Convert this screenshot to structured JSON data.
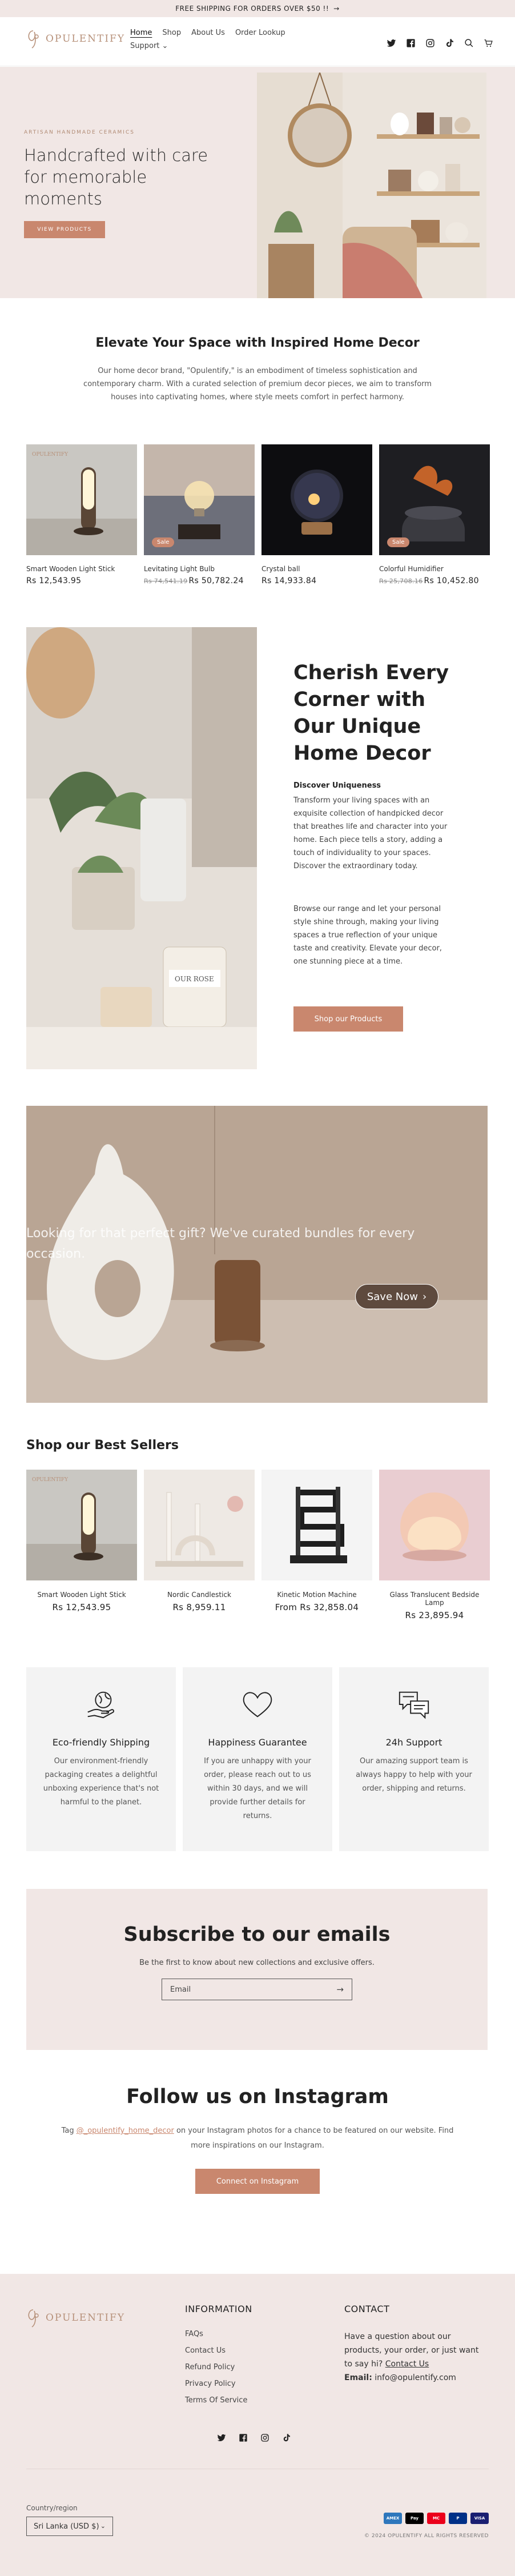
{
  "announcement": {
    "text": "FREE SHIPPING FOR ORDERS OVER $50 !!",
    "arrow": "→"
  },
  "header": {
    "logo_text": "OPULENTIFY",
    "nav": [
      {
        "label": "Home",
        "active": true
      },
      {
        "label": "Shop"
      },
      {
        "label": "About Us"
      },
      {
        "label": "Order Lookup"
      },
      {
        "label": "Support ⌄"
      }
    ],
    "icons": [
      "twitter-icon",
      "facebook-icon",
      "instagram-icon",
      "tiktok-icon",
      "search-icon",
      "cart-icon"
    ]
  },
  "hero": {
    "eyebrow": "ARTISAN HANDMADE CERAMICS",
    "title": "Handcrafted with care for memorable moments",
    "button": "VIEW PRODUCTS"
  },
  "elevate": {
    "title": "Elevate Your Space with Inspired Home Decor",
    "text": "Our home decor brand, \"Opulentify,\" is an embodiment of timeless sophistication and contemporary charm. With a curated selection of premium decor pieces, we aim to transform houses into captivating homes, where style meets comfort in perfect harmony."
  },
  "products": [
    {
      "name": "Smart Wooden Light Stick",
      "price": "Rs 12,543.95",
      "old_price": "",
      "sale": ""
    },
    {
      "name": "Levitating Light Bulb",
      "price": "Rs 50,782.24",
      "old_price": "Rs 74,541.19",
      "sale": "Sale"
    },
    {
      "name": "Crystal ball",
      "price": "Rs 14,933.84",
      "old_price": "",
      "sale": ""
    },
    {
      "name": "Colorful Humidifier",
      "price": "Rs 10,452.80",
      "old_price": "Rs 25,708.16",
      "sale": "Sale"
    }
  ],
  "cherish": {
    "title": "Cherish Every Corner with Our Unique Home Decor",
    "subtitle": "Discover Uniqueness",
    "p1": "Transform your living spaces with an exquisite collection of handpicked decor that breathes life and character into your home. Each piece tells a story, adding a touch of individuality to your spaces. Discover the extraordinary today.",
    "p2": "Browse our range and let your personal style shine through, making your living spaces a true reflection of your unique taste and creativity. Elevate your decor, one stunning piece at a time.",
    "button": "Shop our Products"
  },
  "banner": {
    "text": "Looking for that perfect gift? We've curated bundles for every occasion.",
    "button": "Save Now",
    "arrow": "›"
  },
  "best_sellers": {
    "title": "Shop our Best Sellers",
    "items": [
      {
        "name": "Smart Wooden Light Stick",
        "price": "Rs 12,543.95"
      },
      {
        "name": "Nordic Candlestick",
        "price": "Rs 8,959.11"
      },
      {
        "name": "Kinetic Motion Machine",
        "price": "From Rs 32,858.04"
      },
      {
        "name": "Glass Translucent Bedside Lamp",
        "price": "Rs 23,895.94"
      }
    ]
  },
  "features": [
    {
      "icon": "globe-hand-icon",
      "title": "Eco-friendly Shipping",
      "text": "Our environment-friendly packaging creates a delightful unboxing experience that's not harmful to the planet."
    },
    {
      "icon": "heart-icon",
      "title": "Happiness Guarantee",
      "text": "If you are unhappy with your order, please reach out to us within 30 days, and we will provide further details for returns."
    },
    {
      "icon": "chat-bubbles-icon",
      "title": "24h Support",
      "text": "Our amazing support team is always happy to help with your order, shipping and returns."
    }
  ],
  "subscribe": {
    "title": "Subscribe to our emails",
    "text": "Be the first to know about new collections and exclusive offers.",
    "placeholder": "Email",
    "arrow": "→"
  },
  "instagram": {
    "title": "Follow us on Instagram",
    "text_before": "Tag ",
    "tag": "@_opulentify_home_decor",
    "text_after": " on your Instagram photos for a chance to be featured on our website. Find more inspirations on our Instagram.",
    "button": "Connect on Instagram"
  },
  "footer": {
    "logo_text": "OPULENTIFY",
    "info_title": "INFORMATION",
    "links": [
      "FAQs",
      "Contact Us",
      "Refund Policy",
      "Privacy Policy",
      "Terms Of Service"
    ],
    "contact_title": "CONTACT",
    "contact_text": "Have a question about our products, your order, or just want to say hi?",
    "contact_link": "Contact Us",
    "email_label": "Email:",
    "email": "info@opulentify.com",
    "country_label": "Country/region",
    "country_value": "Sri Lanka (USD $)",
    "chevron": "⌄",
    "payments": [
      {
        "name": "American Express",
        "label": "AMEX",
        "color": "#2e77bc"
      },
      {
        "name": "Apple Pay",
        "label": "Pay",
        "color": "#000000"
      },
      {
        "name": "Mastercard",
        "label": "MC",
        "color": "#eb001b"
      },
      {
        "name": "PayPal",
        "label": "P",
        "color": "#003087"
      },
      {
        "name": "Visa",
        "label": "VISA",
        "color": "#1a1f71"
      }
    ],
    "copyright": "© 2024 OPULENTIFY ALL RIGHTS RESERVED"
  },
  "colors": {
    "accent": "#c9876e",
    "blush": "#f1e7e5",
    "feature_bg": "#f3f3f3"
  }
}
